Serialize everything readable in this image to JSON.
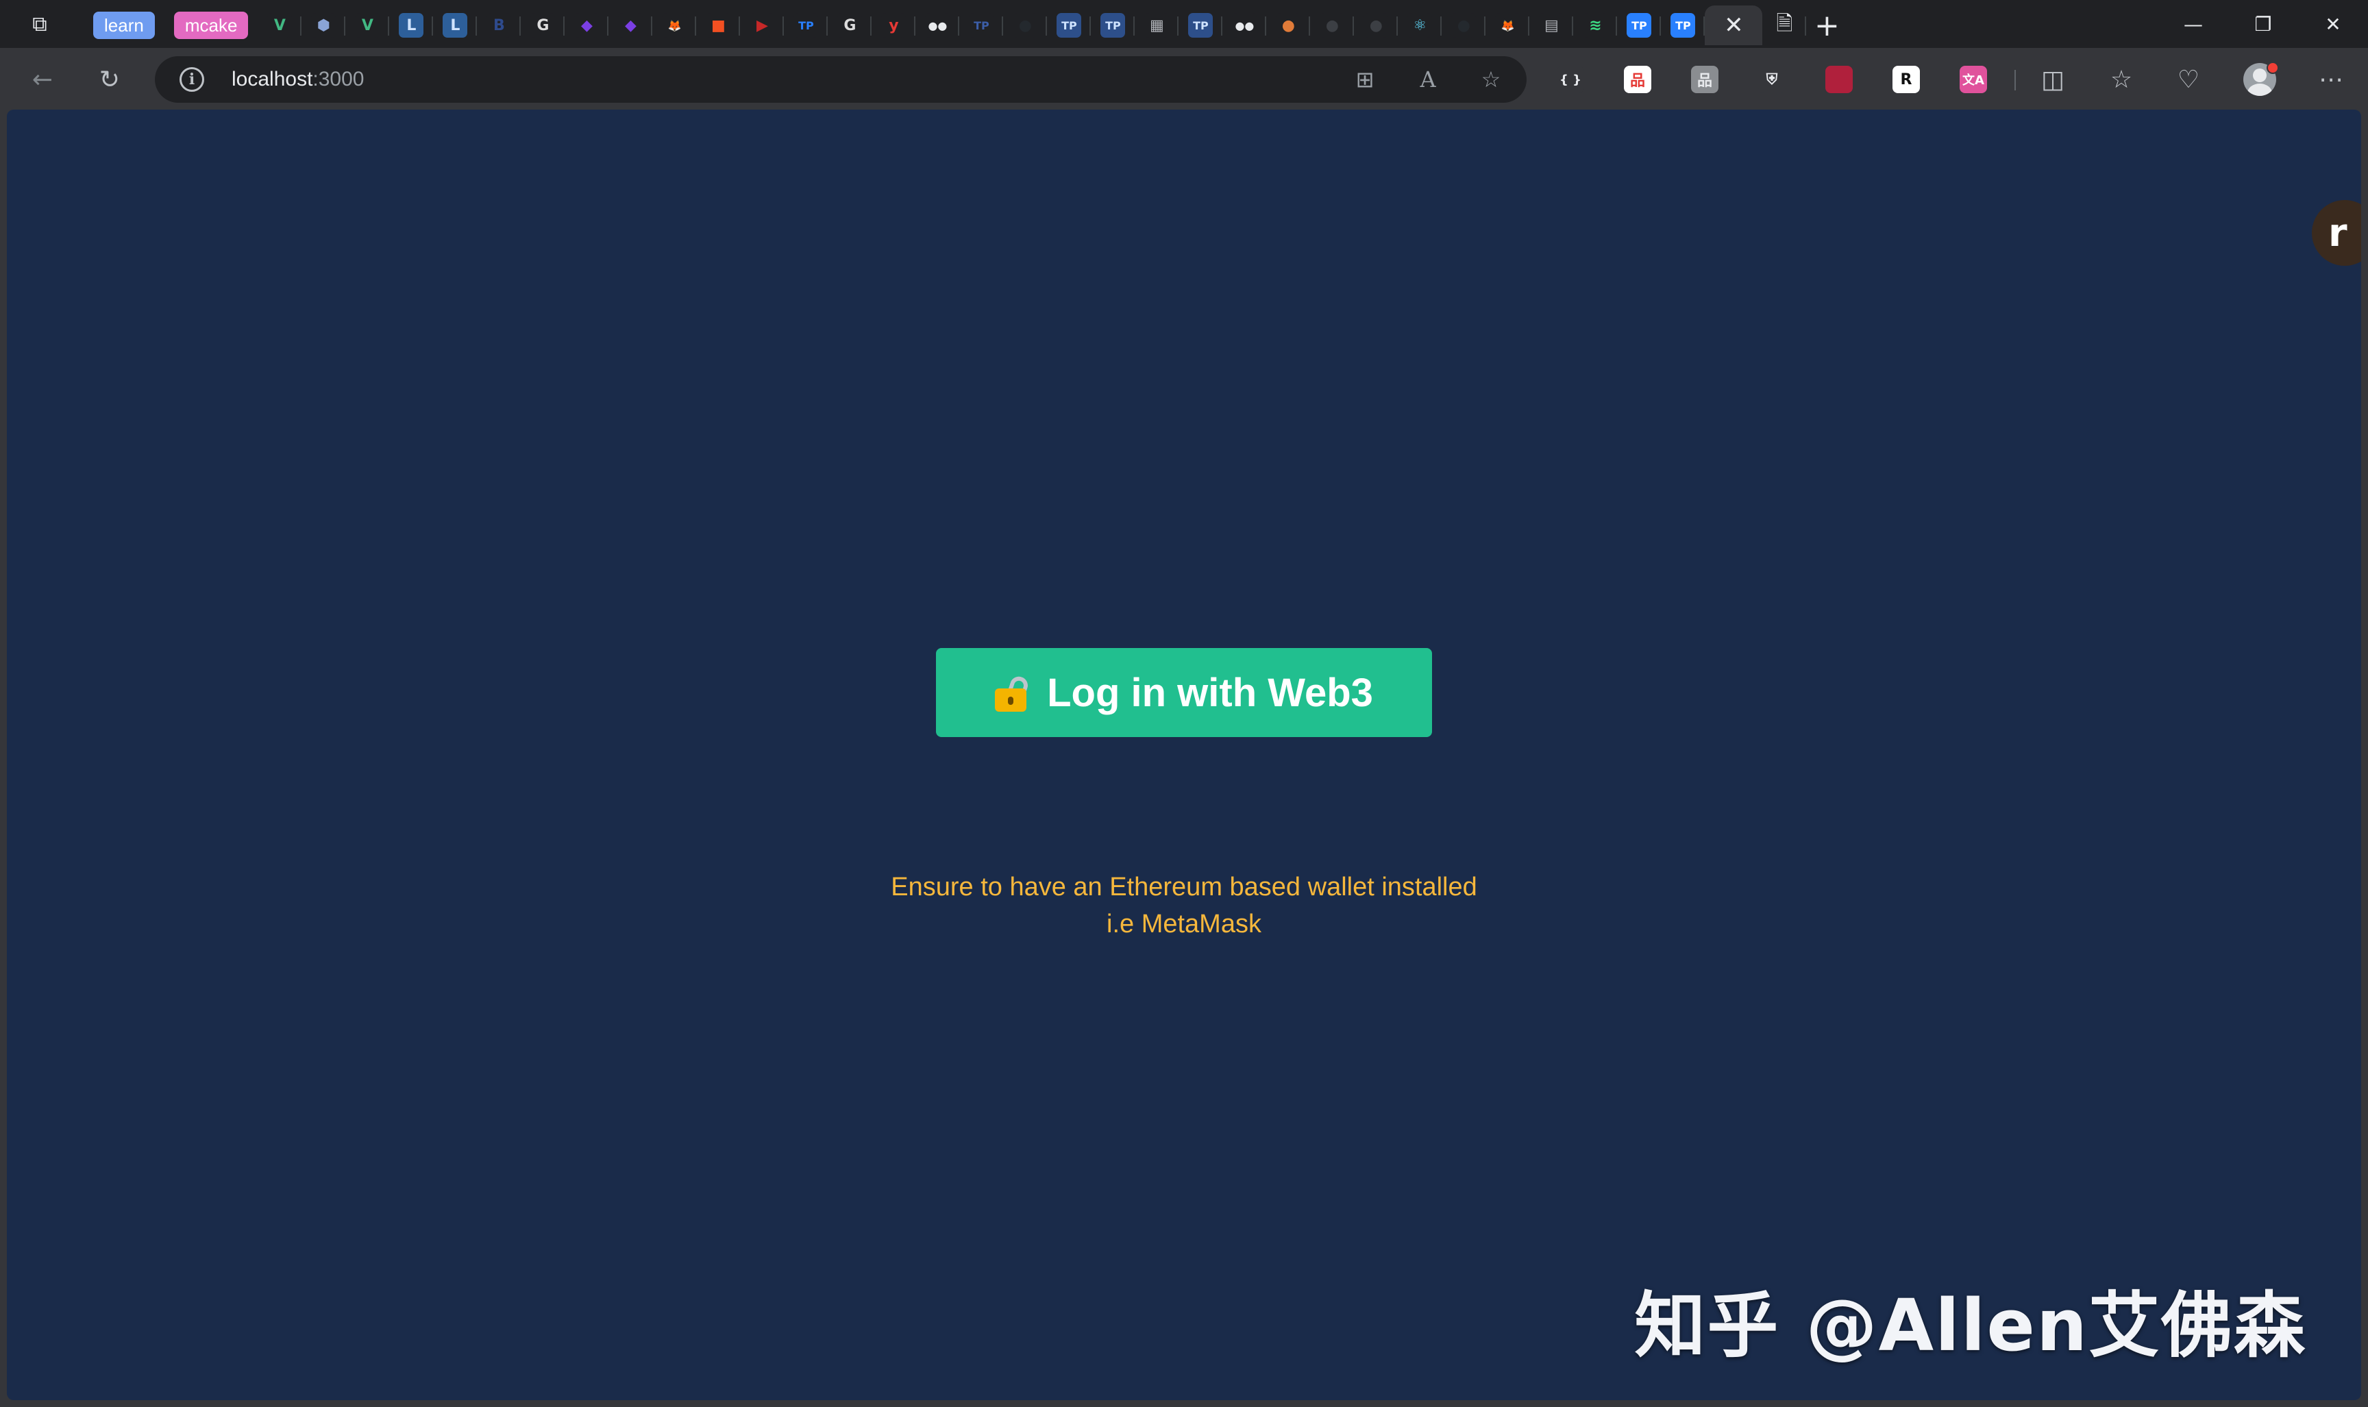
{
  "browser": {
    "tab_groups": [
      {
        "label": "learn",
        "color": "#6f9cf0"
      },
      {
        "label": "mcake",
        "color": "#e36ac1"
      }
    ],
    "tabs": [
      {
        "icon": "vue-icon",
        "glyph": "V",
        "bg": "#202124",
        "fg": "#42b883"
      },
      {
        "icon": "cube-icon",
        "glyph": "⬢",
        "bg": "#202124",
        "fg": "#8aa4d6"
      },
      {
        "icon": "vue-icon",
        "glyph": "V",
        "bg": "#202124",
        "fg": "#42b883"
      },
      {
        "icon": "letter-l-icon",
        "glyph": "L",
        "bg": "#2d5f9a",
        "fg": "#cfe3ff"
      },
      {
        "icon": "letter-l-icon",
        "glyph": "L",
        "bg": "#2d5f9a",
        "fg": "#cfe3ff"
      },
      {
        "icon": "bootstrap-icon",
        "glyph": "B",
        "bg": "#202124",
        "fg": "#2e4a8c"
      },
      {
        "icon": "google-icon",
        "glyph": "G",
        "bg": "#202124",
        "fg": "#dcdcdc"
      },
      {
        "icon": "hexagon-purple-icon",
        "glyph": "◆",
        "bg": "#202124",
        "fg": "#7b3fe4"
      },
      {
        "icon": "hexagon-purple-icon",
        "glyph": "◆",
        "bg": "#202124",
        "fg": "#7b3fe4"
      },
      {
        "icon": "metamask-fox-icon",
        "glyph": "🦊",
        "bg": "#202124",
        "fg": "#f6851b"
      },
      {
        "icon": "microsoft-icon",
        "glyph": "■",
        "bg": "#202124",
        "fg": "#f25022"
      },
      {
        "icon": "youtube-icon",
        "glyph": "▶",
        "bg": "#202124",
        "fg": "#c62828"
      },
      {
        "icon": "tp-wallet-icon",
        "glyph": "TP",
        "bg": "#202124",
        "fg": "#2980fe"
      },
      {
        "icon": "google-icon",
        "glyph": "G",
        "bg": "#202124",
        "fg": "#dcdcdc"
      },
      {
        "icon": "yuque-icon",
        "glyph": "y",
        "bg": "#202124",
        "fg": "#e53935"
      },
      {
        "icon": "medium-icon",
        "glyph": "●●",
        "bg": "#202124",
        "fg": "#e8eaed"
      },
      {
        "icon": "tp-wallet-icon",
        "glyph": "TP",
        "bg": "#202124",
        "fg": "#3c5ea8"
      },
      {
        "icon": "github-icon",
        "glyph": "●",
        "bg": "#202124",
        "fg": "#24292e"
      },
      {
        "icon": "tp-wallet-icon",
        "glyph": "TP",
        "bg": "#2d4f8a",
        "fg": "#cfe3ff"
      },
      {
        "icon": "tp-wallet-icon",
        "glyph": "TP",
        "bg": "#2d4f8a",
        "fg": "#cfe3ff"
      },
      {
        "icon": "store-icon",
        "glyph": "▦",
        "bg": "#202124",
        "fg": "#b0b3b8"
      },
      {
        "icon": "tp-wallet-icon",
        "glyph": "TP",
        "bg": "#2d4f8a",
        "fg": "#cfe3ff"
      },
      {
        "icon": "medium-icon",
        "glyph": "●●",
        "bg": "#202124",
        "fg": "#e8eaed"
      },
      {
        "icon": "app-orange-icon",
        "glyph": "●",
        "bg": "#202124",
        "fg": "#e07b39"
      },
      {
        "icon": "github-icon",
        "glyph": "●",
        "bg": "#202124",
        "fg": "#3c3f44"
      },
      {
        "icon": "github-icon",
        "glyph": "●",
        "bg": "#202124",
        "fg": "#3c3f44"
      },
      {
        "icon": "react-icon",
        "glyph": "⚛",
        "bg": "#202124",
        "fg": "#61dafb"
      },
      {
        "icon": "github-icon",
        "glyph": "●",
        "bg": "#202124",
        "fg": "#24292e"
      },
      {
        "icon": "metamask-fox-icon",
        "glyph": "🦊",
        "bg": "#202124",
        "fg": "#f6851b"
      },
      {
        "icon": "document-icon",
        "glyph": "▤",
        "bg": "#202124",
        "fg": "#b0b3b8"
      },
      {
        "icon": "feather-icon",
        "glyph": "≋",
        "bg": "#202124",
        "fg": "#3ddc84"
      },
      {
        "icon": "tp-wallet-icon",
        "glyph": "TP",
        "bg": "#2980fe",
        "fg": "#ffffff"
      },
      {
        "icon": "tp-wallet-icon",
        "glyph": "TP",
        "bg": "#2980fe",
        "fg": "#ffffff"
      }
    ],
    "active_tab": {
      "icon": "close-icon",
      "glyph": "✕"
    },
    "after_active_tab": {
      "icon": "page-error-icon",
      "glyph": "🗎"
    },
    "new_tab_glyph": "+",
    "window_controls": {
      "minimize": "—",
      "restore": "❐",
      "close": "✕"
    },
    "address": {
      "host": "localhost",
      "port": ":3000"
    },
    "toolbar_glyphs": {
      "back": "←",
      "reload": "↻",
      "apps": "⊞",
      "read_aloud": "A",
      "favorite": "☆",
      "split": "◫",
      "favorites": "☆",
      "performance": "♡",
      "more": "⋯"
    },
    "extensions": [
      {
        "icon": "json-braces-icon",
        "glyph": "{ }",
        "bg": "#35363a",
        "fg": "#e8eaed"
      },
      {
        "icon": "extension-red-icon",
        "glyph": "品",
        "bg": "#ffffff",
        "fg": "#e53935"
      },
      {
        "icon": "extension-grey-icon",
        "glyph": "品",
        "bg": "#8a8d91",
        "fg": "#e8eaed"
      },
      {
        "icon": "shield-icon",
        "glyph": "⛨",
        "bg": "#35363a",
        "fg": "#e8eaed"
      },
      {
        "icon": "extension-crimson-icon",
        "glyph": "■",
        "bg": "#b0203c",
        "fg": "#b0203c"
      },
      {
        "icon": "letter-r-icon",
        "glyph": "R",
        "bg": "#ffffff",
        "fg": "#111111"
      },
      {
        "icon": "translate-icon",
        "glyph": "文A",
        "bg": "#e0529c",
        "fg": "#ffffff"
      }
    ]
  },
  "page": {
    "login_button_label": "Log in with Web3",
    "hint_line1": "Ensure to have an Ethereum based wallet installed",
    "hint_line2": "i.e MetaMask",
    "side_avatar_letter": "r",
    "watermark": "知乎 @Allen艾佛森"
  },
  "colors": {
    "page_background": "#1a2b4a",
    "button": "#21bf8f",
    "hint_text": "#f6b73c"
  }
}
